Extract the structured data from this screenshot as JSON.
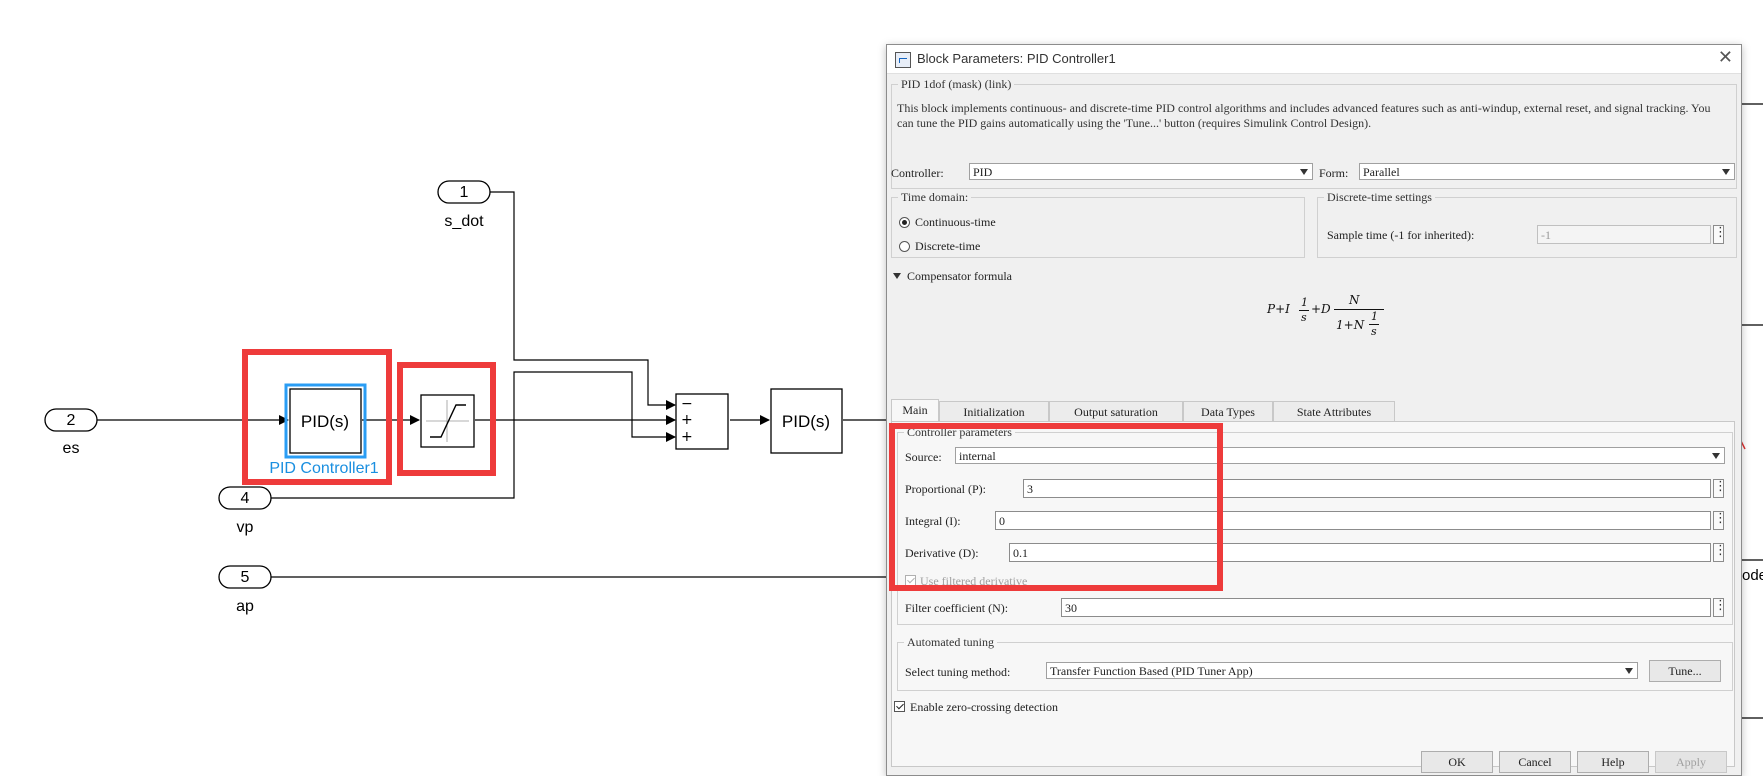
{
  "diagram": {
    "inports": [
      {
        "number": "1",
        "name": "s_dot"
      },
      {
        "number": "2",
        "name": "es"
      },
      {
        "number": "4",
        "name": "vp"
      },
      {
        "number": "5",
        "name": "ap"
      }
    ],
    "pid_block_label": "PID(s)",
    "pid_block_name": "PID Controller1",
    "pid2_block_label": "PID(s)",
    "sum_signs": [
      "−",
      "+",
      "+"
    ],
    "edge_text": "ode"
  },
  "dialog": {
    "title": "Block Parameters: PID Controller1",
    "close_glyph": "✕",
    "mask_group": "PID 1dof (mask) (link)",
    "description": "This block implements continuous- and discrete-time PID control algorithms and includes advanced features such as anti-windup, external reset, and signal tracking. You can tune the PID gains automatically using the 'Tune...' button (requires Simulink Control Design).",
    "controller_label": "Controller:",
    "controller_value": "PID",
    "form_label": "Form:",
    "form_value": "Parallel",
    "time_domain_title": "Time domain:",
    "time_domain_options": [
      "Continuous-time",
      "Discrete-time"
    ],
    "time_domain_selected": 0,
    "discrete_settings_title": "Discrete-time settings",
    "sample_time_label": "Sample time (-1 for inherited):",
    "sample_time_value": "-1",
    "compensator_label": "Compensator formula",
    "formula": {
      "p_term": "P+I",
      "frac1_num": "1",
      "frac1_den": "s",
      "d_term": "+D",
      "num": "N",
      "den_lead": "1+N",
      "den_frac_num": "1",
      "den_frac_den": "s"
    },
    "tabs": [
      "Main",
      "Initialization",
      "Output saturation",
      "Data Types",
      "State Attributes"
    ],
    "active_tab": "Main",
    "controller_params_title": "Controller parameters",
    "source_label": "Source:",
    "source_value": "internal",
    "proportional_label": "Proportional (P):",
    "proportional_value": "3",
    "integral_label": "Integral (I):",
    "integral_value": "0",
    "derivative_label": "Derivative (D):",
    "derivative_value": "0.1",
    "use_filtered_label": "Use filtered derivative",
    "use_filtered_checked": true,
    "filter_label": "Filter coefficient (N):",
    "filter_value": "30",
    "auto_tuning_title": "Automated tuning",
    "tuning_method_label": "Select tuning method:",
    "tuning_method_value": "Transfer Function Based (PID Tuner App)",
    "tune_button": "Tune...",
    "zero_crossing_label": "Enable zero-crossing detection",
    "zero_crossing_checked": true,
    "buttons": [
      "OK",
      "Cancel",
      "Help",
      "Apply"
    ]
  },
  "colors": {
    "highlight": "#ee3b3b",
    "block_selected": "#2a9df4",
    "block_name": "#1a8fe0"
  }
}
